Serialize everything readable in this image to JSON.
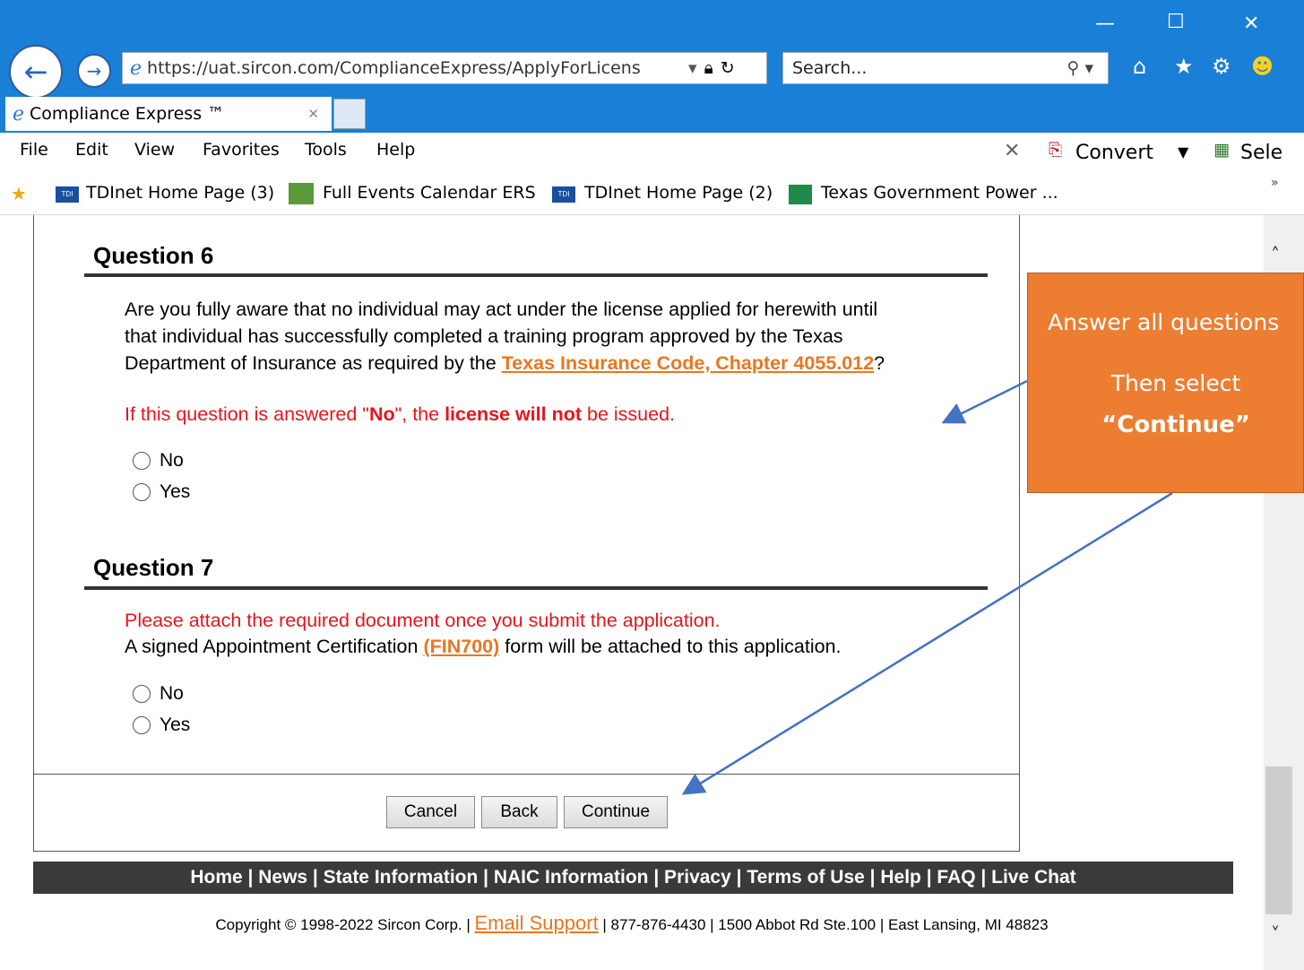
{
  "browser": {
    "url": "https://uat.sircon.com/ComplianceExpress/ApplyForLicens",
    "search_placeholder": "Search...",
    "tab_title": "Compliance Express ™",
    "menu": [
      "File",
      "Edit",
      "View",
      "Favorites",
      "Tools",
      "Help"
    ],
    "convert_label": "Convert",
    "select_label": "Sele",
    "favorites": [
      "TDInet Home Page (3)",
      "Full Events Calendar ERS",
      "TDInet Home Page (2)",
      "Texas Government Power ..."
    ]
  },
  "q6": {
    "title": "Question 6",
    "text_line1": "Are you fully aware that no individual may act under the license applied for herewith until",
    "text_line2": "that individual has successfully completed a training program approved by the Texas",
    "text_line3_pre": "Department of Insurance as required by the ",
    "text_link": "Texas Insurance Code, Chapter 4055.012",
    "text_line3_post": "?",
    "warn_pre": "If this question is answered \"",
    "warn_no": "No",
    "warn_mid": "\", the ",
    "warn_bold": "license will not",
    "warn_post": " be issued.",
    "options": [
      "No",
      "Yes"
    ]
  },
  "q7": {
    "title": "Question 7",
    "red_line": "Please attach the required document once you submit the application.",
    "line2_pre": "A signed Appointment Certification ",
    "line2_link": "(FIN700)",
    "line2_post": " form will be attached to this application.",
    "options": [
      "No",
      "Yes"
    ]
  },
  "buttons": {
    "cancel": "Cancel",
    "back": "Back",
    "continue": "Continue"
  },
  "footer": {
    "links": "Home | News | State Information | NAIC Information | Privacy | Terms of Use | Help | FAQ | Live Chat",
    "copyright_pre": "Copyright © 1998-2022 Sircon Corp. | ",
    "email": "Email Support",
    "copyright_post": " | 877-876-4430 | 1500 Abbot Rd Ste.100 | East Lansing, MI 48823"
  },
  "callout": {
    "line1": "Answer all questions",
    "line2": "Then select",
    "line3": "“Continue”"
  },
  "colors": {
    "accent": "#ed7d31",
    "link": "#e87722",
    "warning": "#e8141c",
    "chrome": "#1a7fd6"
  }
}
